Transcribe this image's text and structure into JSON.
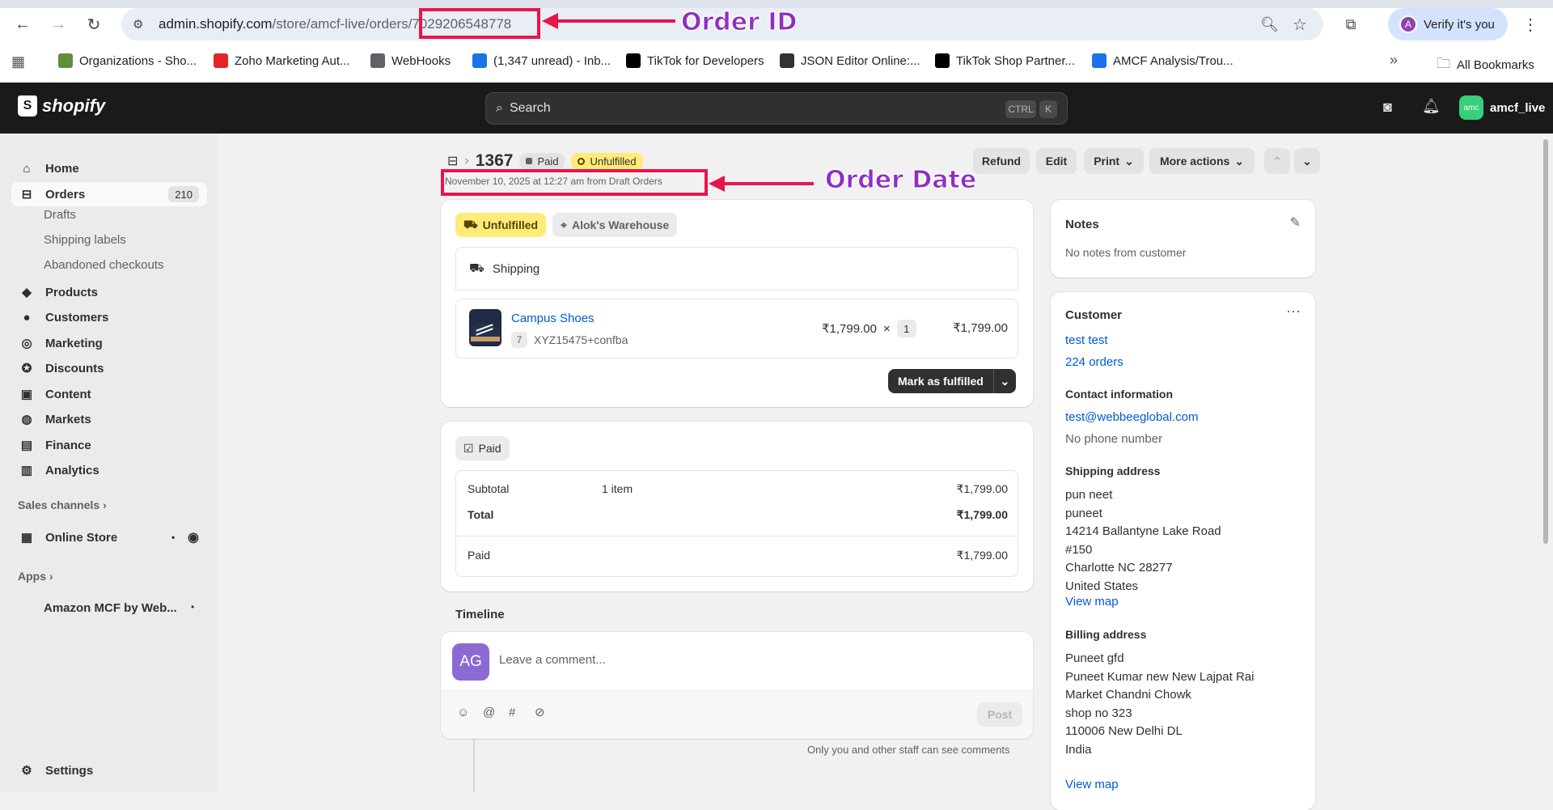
{
  "browser": {
    "url_host": "admin.shopify.com",
    "url_path": "/store/amcf-live/orders/7029206548778",
    "verify_label": "Verify it's you",
    "profile_initial": "A",
    "all_bookmarks": "All Bookmarks",
    "bookmarks": [
      {
        "label": "Organizations - Sho...",
        "icon": "shopify-bag-icon",
        "color": "#5e8e3e"
      },
      {
        "label": "Zoho Marketing Aut...",
        "icon": "zoho-icon",
        "color": "#e42527"
      },
      {
        "label": "WebHooks",
        "icon": "folder-icon",
        "color": "#5f6368"
      },
      {
        "label": "(1,347 unread) - Inb...",
        "icon": "mail-icon",
        "color": "#1a73e8"
      },
      {
        "label": "TikTok for Developers",
        "icon": "tiktok-icon",
        "color": "#000000"
      },
      {
        "label": "JSON Editor Online:...",
        "icon": "json-icon",
        "color": "#333333"
      },
      {
        "label": "TikTok Shop Partner...",
        "icon": "tiktok-icon",
        "color": "#000000"
      },
      {
        "label": "AMCF Analysis/Trou...",
        "icon": "chart-icon",
        "color": "#1a73e8"
      }
    ]
  },
  "annotations": {
    "order_id_label": "Order ID",
    "order_date_label": "Order Date"
  },
  "topbar": {
    "brand": "shopify",
    "search_placeholder": "Search",
    "kbd_ctrl": "CTRL",
    "kbd_k": "K",
    "store_avatar": "amc",
    "store_name": "amcf_live"
  },
  "sidebar": {
    "home": "Home",
    "orders": "Orders",
    "orders_count": "210",
    "drafts": "Drafts",
    "shipping_labels": "Shipping labels",
    "abandoned": "Abandoned checkouts",
    "products": "Products",
    "customers": "Customers",
    "marketing": "Marketing",
    "discounts": "Discounts",
    "content": "Content",
    "markets": "Markets",
    "finance": "Finance",
    "analytics": "Analytics",
    "sales_channels": "Sales channels",
    "online_store": "Online Store",
    "apps": "Apps",
    "amazon_app": "Amazon MCF by Web...",
    "settings": "Settings"
  },
  "order": {
    "number": "1367",
    "paid_badge": "Paid",
    "fulfillment_badge": "Unfulfilled",
    "date_line": "November 10, 2025 at 12:27 am from Draft Orders",
    "actions": {
      "refund": "Refund",
      "edit": "Edit",
      "print": "Print",
      "more": "More actions"
    }
  },
  "fulfillment": {
    "status": "Unfulfilled",
    "location": "Alok's Warehouse",
    "shipping": "Shipping",
    "item_name": "Campus Shoes",
    "item_variant_num": "7",
    "item_sku": "XYZ15475+confba",
    "item_price": "₹1,799.00",
    "times": "×",
    "item_qty": "1",
    "item_total": "₹1,799.00",
    "mark_fulfilled": "Mark as fulfilled"
  },
  "payment": {
    "status": "Paid",
    "subtotal_label": "Subtotal",
    "subtotal_items": "1 item",
    "subtotal_value": "₹1,799.00",
    "total_label": "Total",
    "total_value": "₹1,799.00",
    "paid_label": "Paid",
    "paid_value": "₹1,799.00"
  },
  "timeline": {
    "title": "Timeline",
    "avatar": "AG",
    "comment_placeholder": "Leave a comment...",
    "post": "Post",
    "staff_note": "Only you and other staff can see comments"
  },
  "notes": {
    "title": "Notes",
    "text": "No notes from customer"
  },
  "customer": {
    "title": "Customer",
    "name": "test test",
    "orders": "224 orders",
    "contact_title": "Contact information",
    "email": "test@webbeeglobal.com",
    "phone": "No phone number",
    "shipping_title": "Shipping address",
    "shipping_lines": [
      "pun neet",
      "puneet",
      "14214 Ballantyne Lake Road",
      "#150",
      "Charlotte NC 28277",
      "United States"
    ],
    "view_map": "View map",
    "billing_title": "Billing address",
    "billing_lines": [
      "Puneet gfd",
      "Puneet Kumar new New Lajpat Rai",
      "Market Chandni Chowk",
      "shop no 323",
      "110006 New Delhi DL",
      "India"
    ],
    "view_map2": "View map"
  },
  "colors": {
    "unfulfilled_bg": "#ffeb78",
    "annotation_red": "#e6164d",
    "annotation_purple": "#8e2fc4",
    "link_blue": "#005bd3"
  }
}
